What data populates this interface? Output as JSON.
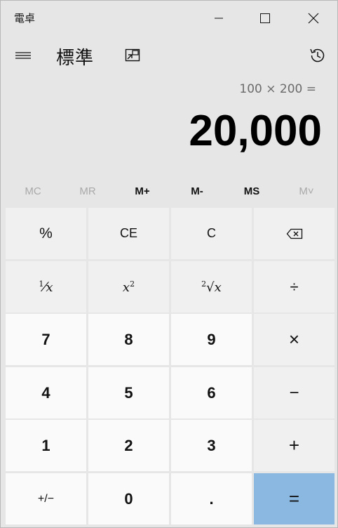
{
  "window": {
    "title": "電卓"
  },
  "header": {
    "mode_title": "標準"
  },
  "display": {
    "expression": "100 × 200 =",
    "result": "20,000"
  },
  "memory": {
    "items": [
      "MC",
      "MR",
      "M+",
      "M-",
      "MS",
      "M˅"
    ]
  },
  "keypad": {
    "percent": "%",
    "clear_entry": "CE",
    "clear": "C",
    "reciprocal_num": "1",
    "reciprocal_x": "x",
    "square_x": "x",
    "square_exp": "2",
    "sqrt_index": "2",
    "sqrt_x": "x",
    "divide": "÷",
    "seven": "7",
    "eight": "8",
    "nine": "9",
    "multiply": "×",
    "four": "4",
    "five": "5",
    "six": "6",
    "minus": "−",
    "one": "1",
    "two": "2",
    "three": "3",
    "plus": "+",
    "negate": "+/−",
    "zero": "0",
    "decimal": ".",
    "equals": "="
  },
  "colors": {
    "window_bg": "#e6e6e6",
    "number_key_bg": "#fafafa",
    "function_key_bg": "#f0f0f0",
    "equals_bg": "#8ab8e0",
    "disabled_text": "#a9a9a9"
  }
}
